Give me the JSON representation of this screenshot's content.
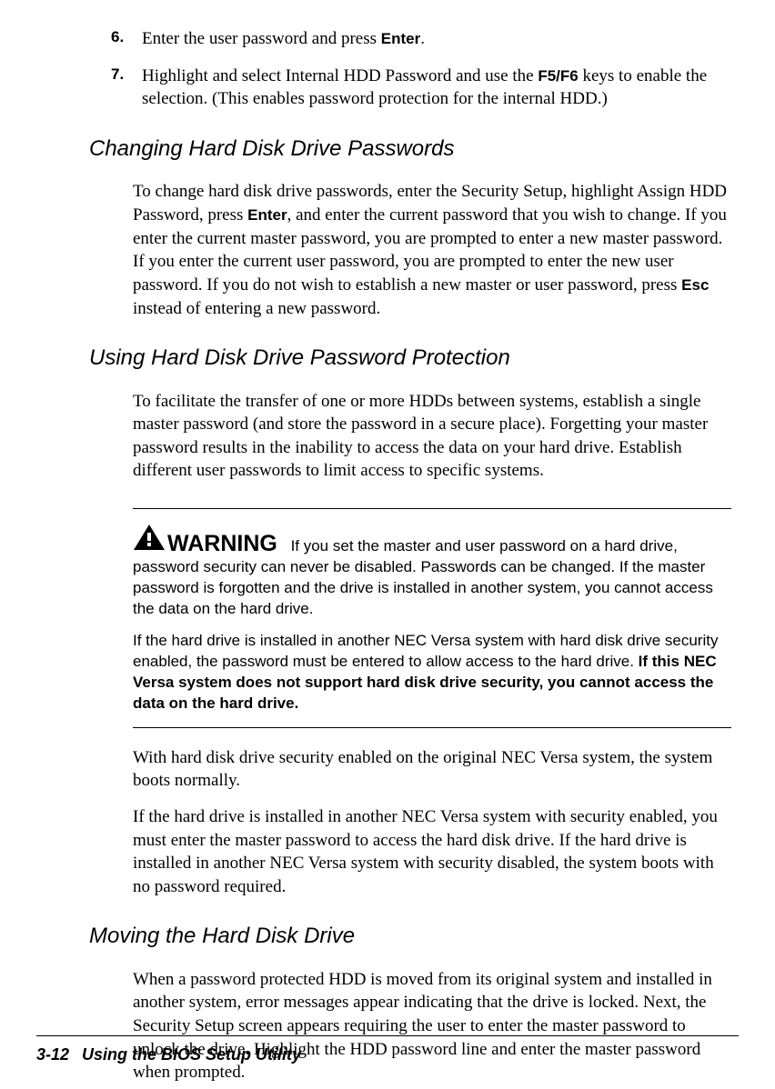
{
  "list": {
    "item6": {
      "num": "6.",
      "pre": "Enter the user password and press ",
      "bold1": "Enter",
      "post": "."
    },
    "item7": {
      "num": "7.",
      "pre": "Highlight and select Internal HDD Password and use the ",
      "bold1": "F5/F6",
      "post": " keys to enable the selection. (This enables password protection for the internal HDD.)"
    }
  },
  "headings": {
    "changing": "Changing Hard Disk Drive Passwords",
    "using": "Using Hard Disk Drive Password Protection",
    "moving": "Moving the Hard Disk Drive"
  },
  "changing": {
    "p1": {
      "pre": "To change hard disk drive passwords, enter the Security Setup, highlight Assign HDD Password, press ",
      "bold1": "Enter",
      "mid": ", and enter the current password that you wish to change. If you enter the current master password, you are prompted to enter a new master password. If you enter the current user password, you are prompted to enter the new user password. If you do not wish to establish a new master or user password, press ",
      "bold2": "Esc",
      "post": " instead of entering a new password."
    }
  },
  "using": {
    "p1": "To facilitate the transfer of one or more HDDs between systems, establish a single master password (and store the password in a secure place). Forgetting your master password results in the inability to access the data on your hard drive. Establish different user passwords to limit access to specific systems.",
    "p2": "With hard disk drive security enabled on the original NEC Versa system, the system boots normally.",
    "p3": "If the hard drive is installed in another NEC Versa system with security enabled, you must enter the master password to access the hard disk drive. If the hard drive is installed in another NEC Versa system with security disabled, the system boots with no password required."
  },
  "warning": {
    "label": "WARNING",
    "p1": "If you set the master and user password on a hard drive, password security can never be disabled. Passwords can be changed. If the master password is forgotten and the drive is installed in another system, you cannot access the data on the hard drive.",
    "p2pre": "If the hard drive is installed in another NEC Versa system with hard disk drive security enabled, the password must be entered to allow access to the hard drive. ",
    "p2bold": "If this NEC Versa system does not support hard disk drive security, you cannot access the data on the hard drive."
  },
  "moving": {
    "p1": "When a password protected HDD is moved from its original system and installed in another system, error messages appear indicating that the drive is locked. Next, the Security Setup screen appears requiring the user to enter the master password to unlock the drive. Highlight the HDD password line and enter the master password when prompted."
  },
  "footer": {
    "page": "3-12",
    "title": "Using the BIOS Setup Utility"
  }
}
